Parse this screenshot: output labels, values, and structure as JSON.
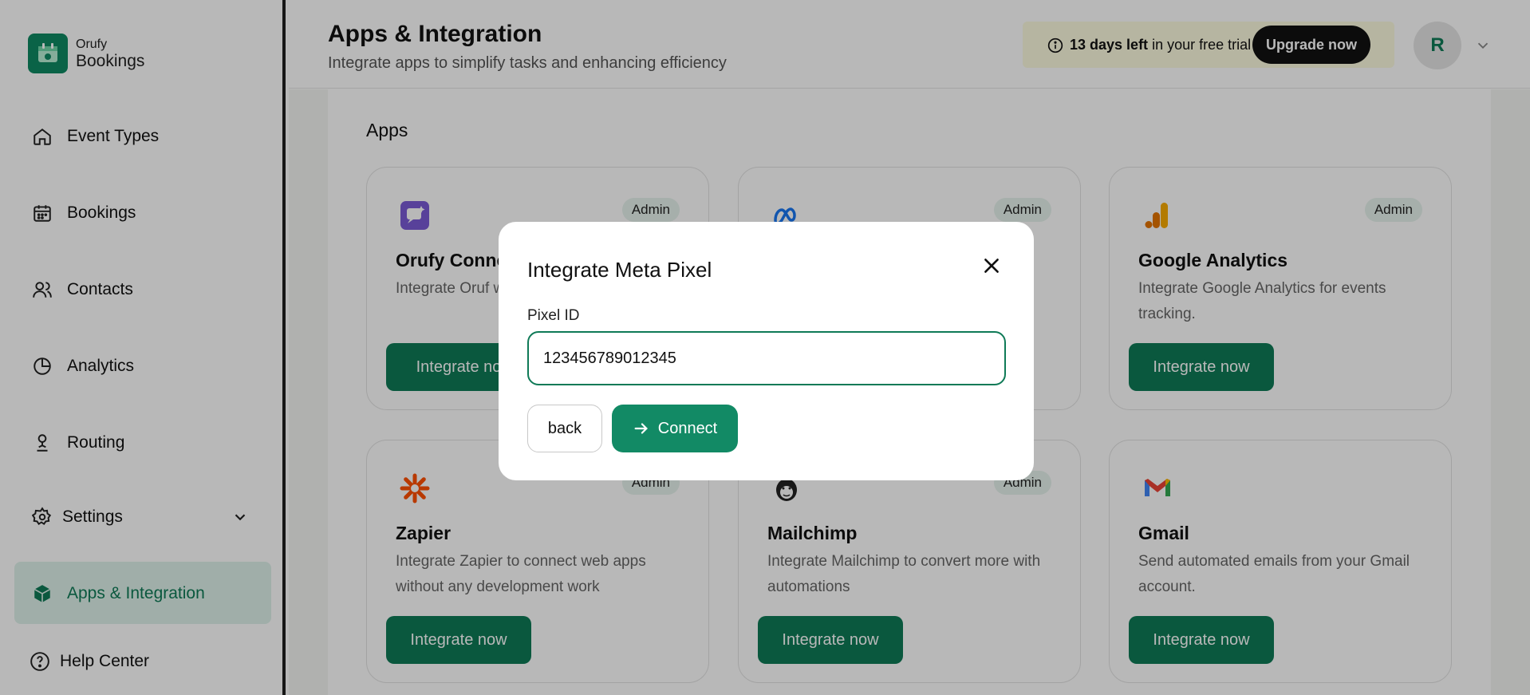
{
  "brand": {
    "small": "Orufy",
    "big": "Bookings"
  },
  "sidebar": {
    "items": [
      {
        "label": "Event Types",
        "icon": "home-icon"
      },
      {
        "label": "Bookings",
        "icon": "calendar-icon"
      },
      {
        "label": "Contacts",
        "icon": "users-icon"
      },
      {
        "label": "Analytics",
        "icon": "pie-chart-icon"
      },
      {
        "label": "Routing",
        "icon": "routing-icon"
      },
      {
        "label": "Settings",
        "icon": "gear-icon"
      },
      {
        "label": "Apps & Integration",
        "icon": "cube-icon",
        "active": true
      },
      {
        "label": "Help Center",
        "icon": "help-icon"
      }
    ]
  },
  "header": {
    "title": "Apps & Integration",
    "subtitle": "Integrate apps to simplify tasks and enhancing efficiency",
    "trial_days": "13 days left",
    "trial_rest": "in your free trial",
    "upgrade_label": "Upgrade now",
    "avatar_initial": "R"
  },
  "main": {
    "section_title": "Apps",
    "cards": [
      {
        "title": "Orufy Conne",
        "desc": "Integrate Oruf with your cust",
        "badge": "Admin",
        "button": "Integrate no"
      },
      {
        "title": "",
        "desc": "",
        "badge": "Admin",
        "button": ""
      },
      {
        "title": "Google Analytics",
        "desc": "Integrate Google Analytics for events tracking.",
        "badge": "Admin",
        "button": "Integrate now"
      },
      {
        "title": "Zapier",
        "desc": "Integrate Zapier to connect web apps without any development work",
        "badge": "Admin",
        "button": "Integrate now"
      },
      {
        "title": "Mailchimp",
        "desc": "Integrate Mailchimp to convert more with automations",
        "badge": "Admin",
        "button": "Integrate now"
      },
      {
        "title": "Gmail",
        "desc": "Send automated emails from your Gmail account.",
        "badge": "",
        "button": "Integrate now"
      }
    ]
  },
  "modal": {
    "title": "Integrate Meta Pixel",
    "field_label": "Pixel ID",
    "field_value": "123456789012345",
    "back_label": "back",
    "connect_label": "Connect"
  }
}
